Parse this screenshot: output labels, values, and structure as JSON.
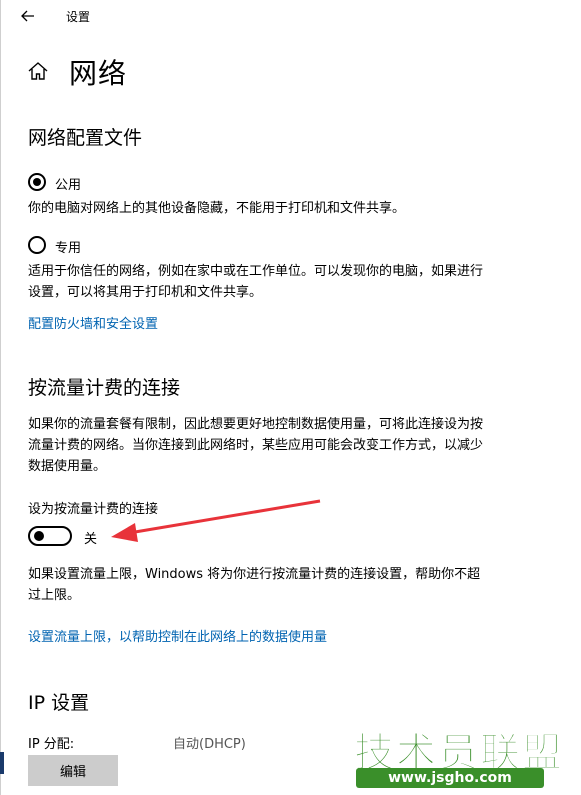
{
  "window": {
    "title": "设置"
  },
  "page": {
    "title": "网络"
  },
  "profile": {
    "heading": "网络配置文件",
    "public": {
      "label": "公用",
      "checked": true,
      "desc": "你的电脑对网络上的其他设备隐藏，不能用于打印机和文件共享。"
    },
    "private": {
      "label": "专用",
      "checked": false,
      "desc": "适用于你信任的网络，例如在家中或在工作单位。可以发现你的电脑，如果进行设置，可以将其用于打印机和文件共享。"
    },
    "firewall_link": "配置防火墙和安全设置"
  },
  "metered": {
    "heading": "按流量计费的连接",
    "desc": "如果你的流量套餐有限制，因此想要更好地控制数据使用量，可将此连接设为按流量计费的网络。当你连接到此网络时，某些应用可能会改变工作方式，以减少数据使用量。",
    "toggle_label": "设为按流量计费的连接",
    "toggle_state": "关",
    "toggle_on": false,
    "limit_desc": "如果设置流量上限，Windows 将为你进行按流量计费的连接设置，帮助你不超过上限。",
    "limit_link": "设置流量上限，以帮助控制在此网络上的数据使用量"
  },
  "ip": {
    "heading": "IP 设置",
    "assign_label": "IP 分配:",
    "assign_value": "自动(DHCP)",
    "edit_button": "编辑"
  },
  "watermark": {
    "text": "技术员联盟",
    "url": "www.jsgho.com"
  },
  "colors": {
    "link": "#0063b1",
    "annotation_arrow": "#e8333a",
    "watermark": "#3a8f2a"
  },
  "icons": {
    "back": "back-arrow-icon",
    "home": "home-icon"
  }
}
